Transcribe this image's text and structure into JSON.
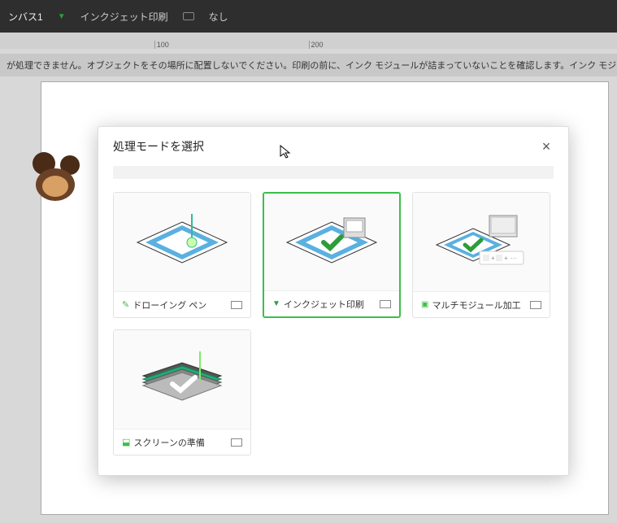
{
  "topbar": {
    "canvas_label": "ンバス1",
    "mode_label": "インクジェット印刷",
    "none_label": "なし"
  },
  "ruler": {
    "t100": "100",
    "t200": "200"
  },
  "warning_text": "が処理できません。オブジェクトをその場所に配置しないでください。印刷の前に、インク モジュールが詰まっていないことを確認します。インク モジュールのテスト",
  "modal": {
    "title": "処理モードを選択",
    "cards": [
      {
        "label": "ドローイング ペン"
      },
      {
        "label": "インクジェット印刷"
      },
      {
        "label": "マルチモジュール加工"
      },
      {
        "label": "スクリーンの準備"
      }
    ]
  }
}
